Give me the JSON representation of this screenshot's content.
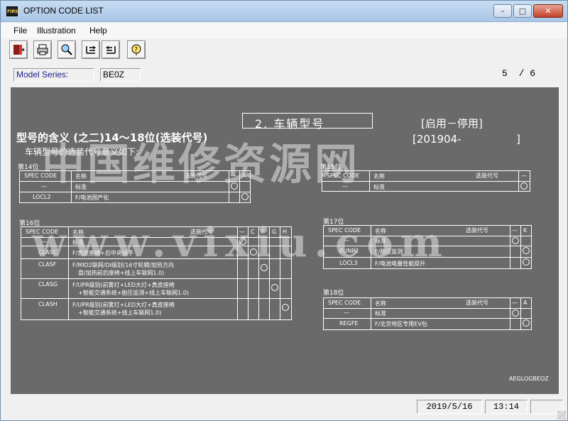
{
  "window": {
    "title": "OPTION CODE LIST",
    "app_icon_text": "FIRST",
    "controls": {
      "minimize": "–",
      "maximize": "□",
      "close": "✕"
    }
  },
  "menu": {
    "items": [
      "File",
      "Illustration",
      "Help"
    ]
  },
  "toolbar": {
    "buttons": [
      "exit-icon",
      "print-icon",
      "search-icon",
      "first-page-icon",
      "last-page-icon",
      "help-icon"
    ]
  },
  "info": {
    "model_series_label": "Model Series:",
    "model_series_value": "BE0Z",
    "page_current": "5",
    "page_total": "/ 6"
  },
  "document": {
    "heading": "2. 车辆型号",
    "heading_note": "[启用－停用]",
    "date_range": "[201904-",
    "date_range_end": "]",
    "subtitle": "型号的含义 (之二)14～18位(选装代号)",
    "subtitle2": "车辆型号的选装代号意义如下:",
    "watermark_cn": "中国维修资源网",
    "watermark_url": "www.vixiu.com",
    "doc_code": "AEGLOGBEOZ",
    "sections": {
      "s14": {
        "label": "第14位",
        "header": [
          "SPEC CODE",
          "名称",
          "选装代号",
          "—",
          "A"
        ],
        "rows": [
          [
            "—",
            "标准"
          ],
          [
            "LOCL2",
            "F/电池国产化"
          ]
        ]
      },
      "s15": {
        "label": "第15位",
        "header": [
          "SPEC CODE",
          "名称",
          "选装代号",
          "—"
        ],
        "rows": [
          [
            "—",
            "标准"
          ]
        ]
      },
      "s16": {
        "label": "第16位",
        "header": [
          "SPEC CODE",
          "名称",
          "选装代号",
          "—",
          "C",
          "F",
          "G",
          "H"
        ],
        "rows": [
          [
            "—",
            "标准"
          ],
          [
            "CLASC",
            "F/真皮座椅+后中央扶手"
          ],
          [
            "CLASF",
            "F/MID2联网/DI级别(16寸轮辋/加热方向",
            "盘/加热前后座椅+线上车联网1.0)"
          ],
          [
            "CLASG",
            "F/UPR级别(前雾灯+LED大灯+真皮座椅",
            "+智能交通系统+胎压监测+线上车联网1.0)"
          ],
          [
            "CLASH",
            "F/UPR级别(前雾灯+LED大灯+真皮座椅",
            "+智能交通系统+线上车联网1.0)"
          ]
        ]
      },
      "s17": {
        "label": "第17位",
        "header": [
          "SPEC CODE",
          "名称",
          "选装代号",
          "—",
          "K"
        ],
        "rows": [
          [
            "—",
            "标准"
          ],
          [
            "RUNP2",
            "F/胎压监测"
          ],
          [
            "LOCL3",
            "F/电池电量性能提升"
          ]
        ]
      },
      "s18": {
        "label": "第18位",
        "header": [
          "SPEC CODE",
          "名称",
          "选装代号",
          "—",
          "A"
        ],
        "rows": [
          [
            "—",
            "标准"
          ],
          [
            "REGFE",
            "F/北京地区专用EV包"
          ]
        ]
      }
    }
  },
  "status": {
    "date": "2019/5/16",
    "time": "13:14"
  },
  "colors": {
    "document_bg": "#6a6a6a",
    "title_bar": "#b9d1ea",
    "label_blue": "#1a1f8c"
  }
}
